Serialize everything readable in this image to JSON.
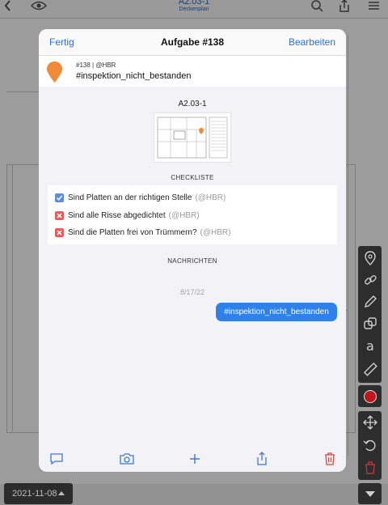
{
  "background": {
    "document": {
      "title": "A2.03-1",
      "subtitle": "Deckenplan"
    },
    "date_picker": {
      "value": "2021-11-08"
    },
    "tools": [
      "map-pin-icon",
      "link-icon",
      "pencil-icon",
      "copy-shapes-icon",
      "text-a-icon",
      "ruler-icon",
      "record-dot-icon",
      "move-arrows-icon",
      "rotate-icon",
      "delete-icon"
    ]
  },
  "modal": {
    "nav": {
      "done_label": "Fertig",
      "title": "Aufgabe #138",
      "edit_label": "Bearbeiten"
    },
    "task": {
      "meta": "#138 | @HBR",
      "tag": "#inspektion_nicht_bestanden",
      "pin_color": "#f08a36"
    },
    "sheet": {
      "name": "A2.03-1"
    },
    "checklist": {
      "heading": "CHECKLISTE",
      "items": [
        {
          "label": "Sind Platten an der richtigen Stelle",
          "assignee": "(@HBR)",
          "state": "checked"
        },
        {
          "label": "Sind alle Risse abgedichtet",
          "assignee": "(@HBR)",
          "state": "failed"
        },
        {
          "label": "Sind die Platten frei von Trümmern?",
          "assignee": "(@HBR)",
          "state": "failed"
        }
      ]
    },
    "messages": {
      "heading": "NACHRICHTEN",
      "date": "8/17/22",
      "items": [
        {
          "text": "#inspektion_nicht_bestanden"
        }
      ]
    },
    "bottom_bar": [
      "comment-icon",
      "camera-icon",
      "plus-icon",
      "share-icon",
      "trash-icon"
    ]
  },
  "colors": {
    "accent": "#2e6fd6",
    "bubble": "#2f80e8",
    "danger": "#e45e5e",
    "checked": "#5b8fd9"
  }
}
